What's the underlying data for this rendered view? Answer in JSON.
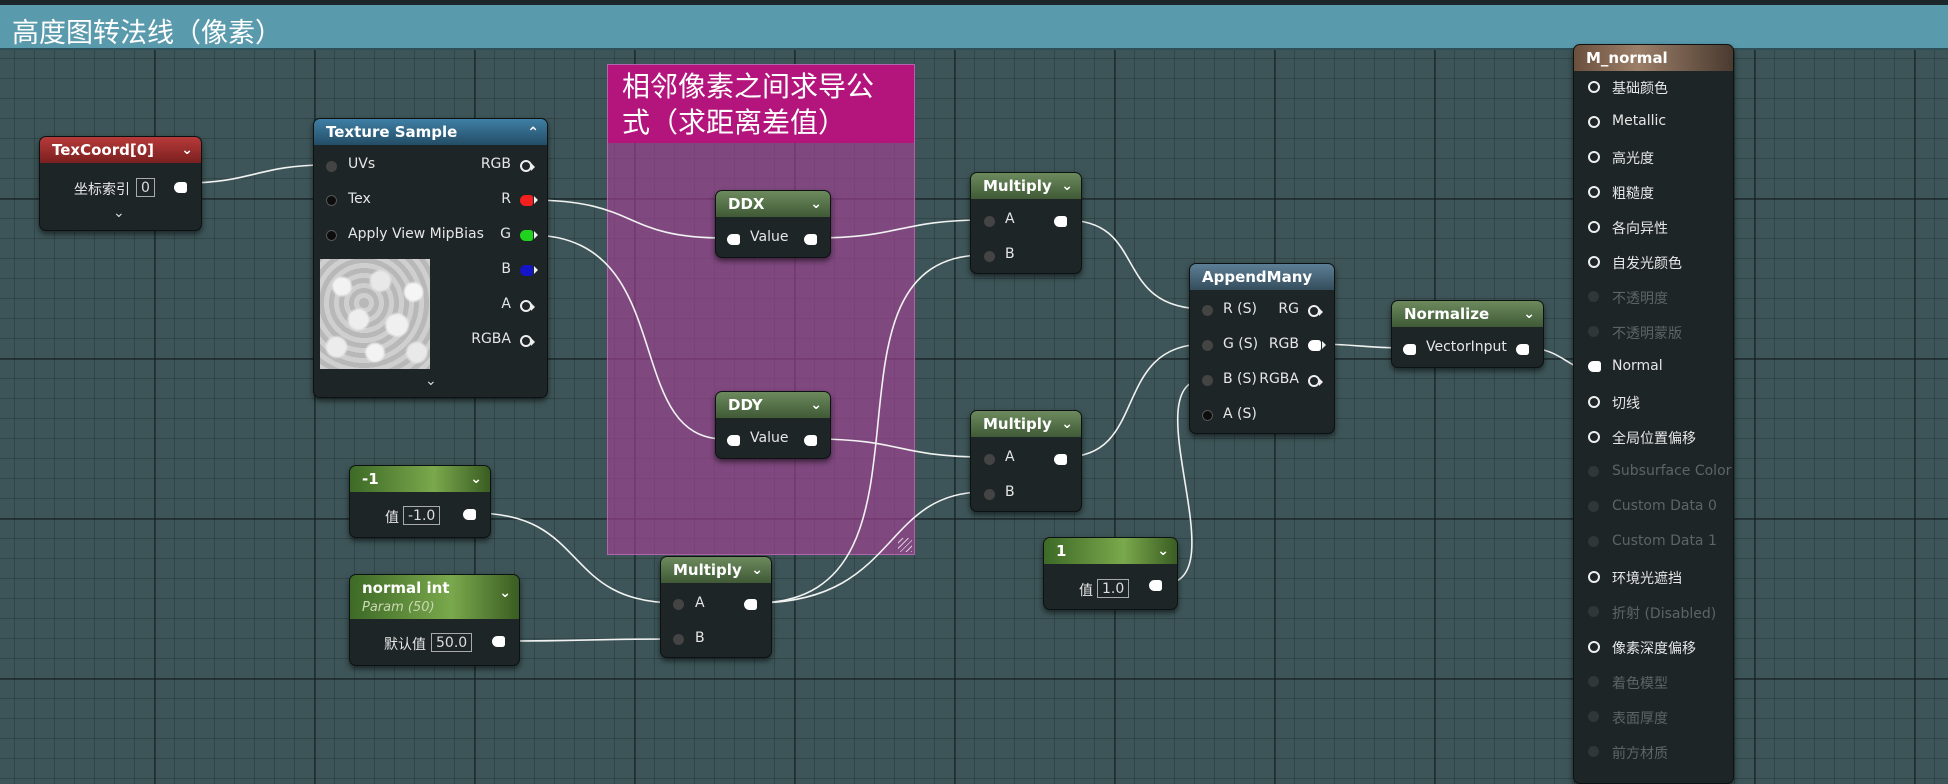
{
  "title": "高度图转法线（像素）",
  "comment": {
    "text": "相邻像素之间求导公式（求距离差值）"
  },
  "nodes": {
    "texcoord": {
      "title": "TexCoord[0]",
      "label": "坐标索引",
      "value": "0",
      "expand": "⌄"
    },
    "texture_sample": {
      "title": "Texture Sample",
      "inputs": [
        "UVs",
        "Tex",
        "Apply View MipBias"
      ],
      "outputs": [
        "RGB",
        "R",
        "G",
        "B",
        "A",
        "RGBA"
      ],
      "expand": "⌄"
    },
    "ddx": {
      "title": "DDX",
      "pin": "Value"
    },
    "ddy": {
      "title": "DDY",
      "pin": "Value"
    },
    "multiply_top": {
      "title": "Multiply",
      "in_a": "A",
      "in_b": "B"
    },
    "multiply_mid": {
      "title": "Multiply",
      "in_a": "A",
      "in_b": "B"
    },
    "multiply_bottom": {
      "title": "Multiply",
      "in_a": "A",
      "in_b": "B"
    },
    "const_neg": {
      "title": "-1",
      "label": "值",
      "value": "-1.0"
    },
    "normal_int": {
      "title": "normal int",
      "subtitle": "Param (50)",
      "label": "默认值",
      "value": "50.0"
    },
    "const_one": {
      "title": "1",
      "label": "值",
      "value": "1.0"
    },
    "append_many": {
      "title": "AppendMany",
      "inputs": [
        "R (S)",
        "G (S)",
        "B (S)",
        "A (S)"
      ],
      "outputs": [
        "RG",
        "RGB",
        "RGBA"
      ]
    },
    "normalize": {
      "title": "Normalize",
      "pin": "VectorInput"
    }
  },
  "material": {
    "title": "M_normal",
    "items": [
      {
        "label": "基础颜色",
        "state": "enabled"
      },
      {
        "label": "Metallic",
        "state": "enabled"
      },
      {
        "label": "高光度",
        "state": "enabled"
      },
      {
        "label": "粗糙度",
        "state": "enabled"
      },
      {
        "label": "各向异性",
        "state": "enabled"
      },
      {
        "label": "自发光颜色",
        "state": "enabled"
      },
      {
        "label": "不透明度",
        "state": "disabled"
      },
      {
        "label": "不透明蒙版",
        "state": "disabled"
      },
      {
        "label": "Normal",
        "state": "connected"
      },
      {
        "label": "切线",
        "state": "enabled"
      },
      {
        "label": "全局位置偏移",
        "state": "enabled"
      },
      {
        "label": "Subsurface Color",
        "state": "disabled"
      },
      {
        "label": "Custom Data 0",
        "state": "disabled"
      },
      {
        "label": "Custom Data 1",
        "state": "disabled"
      },
      {
        "label": "环境光遮挡",
        "state": "enabled"
      },
      {
        "label": "折射 (Disabled)",
        "state": "disabled"
      },
      {
        "label": "像素深度偏移",
        "state": "enabled"
      },
      {
        "label": "着色模型",
        "state": "disabled"
      },
      {
        "label": "表面厚度",
        "state": "disabled"
      },
      {
        "label": "前方材质",
        "state": "disabled"
      }
    ]
  },
  "colors": {
    "background": "#3d5558",
    "title_bar": "#5a9aad",
    "comment_header": "#b4157c",
    "pin_r": "#f51f1f",
    "pin_g": "#1fd31f",
    "pin_b": "#1515c8"
  }
}
